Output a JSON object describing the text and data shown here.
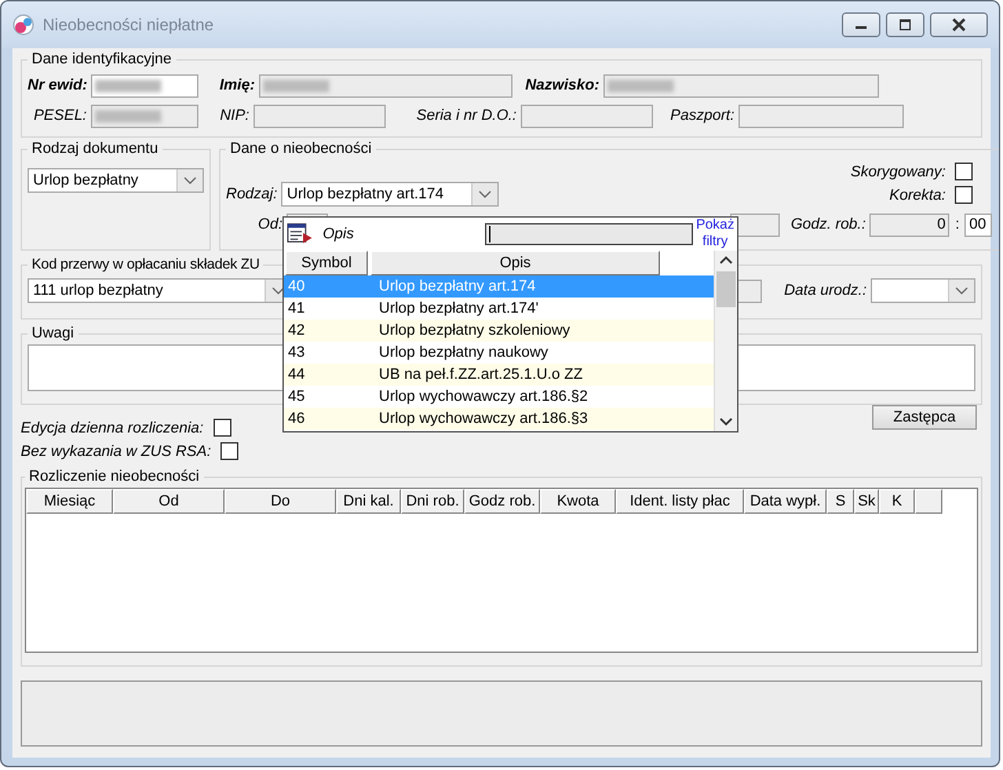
{
  "window": {
    "title": "Nieobecności niepłatne"
  },
  "identification": {
    "legend": "Dane identyfikacyjne",
    "rows": [
      {
        "emphasis": true,
        "fields": [
          {
            "label": "Nr ewid:",
            "editable": true,
            "redacted": true
          },
          {
            "label": "Imię:",
            "editable": false,
            "redacted": true
          },
          {
            "label": "Nazwisko:",
            "editable": false,
            "redacted": true
          }
        ]
      },
      {
        "emphasis": false,
        "fields": [
          {
            "label": "PESEL:",
            "editable": false,
            "redacted": true
          },
          {
            "label": "NIP:",
            "editable": false,
            "redacted": false
          },
          {
            "label": "Seria i nr D.O.:",
            "editable": false,
            "redacted": false
          },
          {
            "label": "Paszport:",
            "editable": false,
            "redacted": false
          }
        ]
      }
    ]
  },
  "document_type": {
    "legend": "Rodzaj dokumentu",
    "value": "Urlop bezpłatny"
  },
  "absence": {
    "legend": "Dane o nieobecności",
    "type_label": "Rodzaj:",
    "type_value": "Urlop bezpłatny art.174",
    "from_label": "Od:",
    "corrected": {
      "label": "Skorygowany:",
      "checked": false
    },
    "correction": {
      "label": "Korekta:",
      "checked": false
    },
    "hours_label": "Godz. rob.:",
    "hours": "0",
    "separator": ":",
    "minutes": "00"
  },
  "break_code": {
    "legend": "Kod przerwy w opłacaniu składek ZU",
    "value": "111 urlop bezpłatny",
    "birth_label": "Data urodz.:"
  },
  "notes": {
    "legend": "Uwagi"
  },
  "options": [
    {
      "label": "Edycja dzienna rozliczenia:",
      "checked": false
    },
    {
      "label": "Bez wykazania w ZUS RSA:",
      "checked": false
    }
  ],
  "substitute_button": "Zastępca",
  "settlement": {
    "legend": "Rozliczenie nieobecności",
    "columns": [
      "Miesiąc",
      "Od",
      "Do",
      "Dni kal.",
      "Dni rob.",
      "Godz rob.",
      "Kwota",
      "Ident. listy płac",
      "Data wypł.",
      "S",
      "Sk",
      "K"
    ]
  },
  "popup": {
    "search_label": "Opis",
    "filters_link": "Pokaż filtry",
    "columns": [
      "Symbol",
      "Opis"
    ],
    "rows": [
      {
        "symbol": "40",
        "description": "Urlop bezpłatny art.174",
        "selected": true
      },
      {
        "symbol": "41",
        "description": "Urlop bezpłatny art.174'",
        "selected": false
      },
      {
        "symbol": "42",
        "description": "Urlop bezpłatny szkoleniowy",
        "selected": false
      },
      {
        "symbol": "43",
        "description": "Urlop bezpłatny naukowy",
        "selected": false
      },
      {
        "symbol": "44",
        "description": "UB na peł.f.ZZ.art.25.1.U.o ZZ",
        "selected": false
      },
      {
        "symbol": "45",
        "description": "Urlop wychowawczy art.186.§2",
        "selected": false
      },
      {
        "symbol": "46",
        "description": "Urlop wychowawczy art.186.§3",
        "selected": false
      }
    ]
  }
}
